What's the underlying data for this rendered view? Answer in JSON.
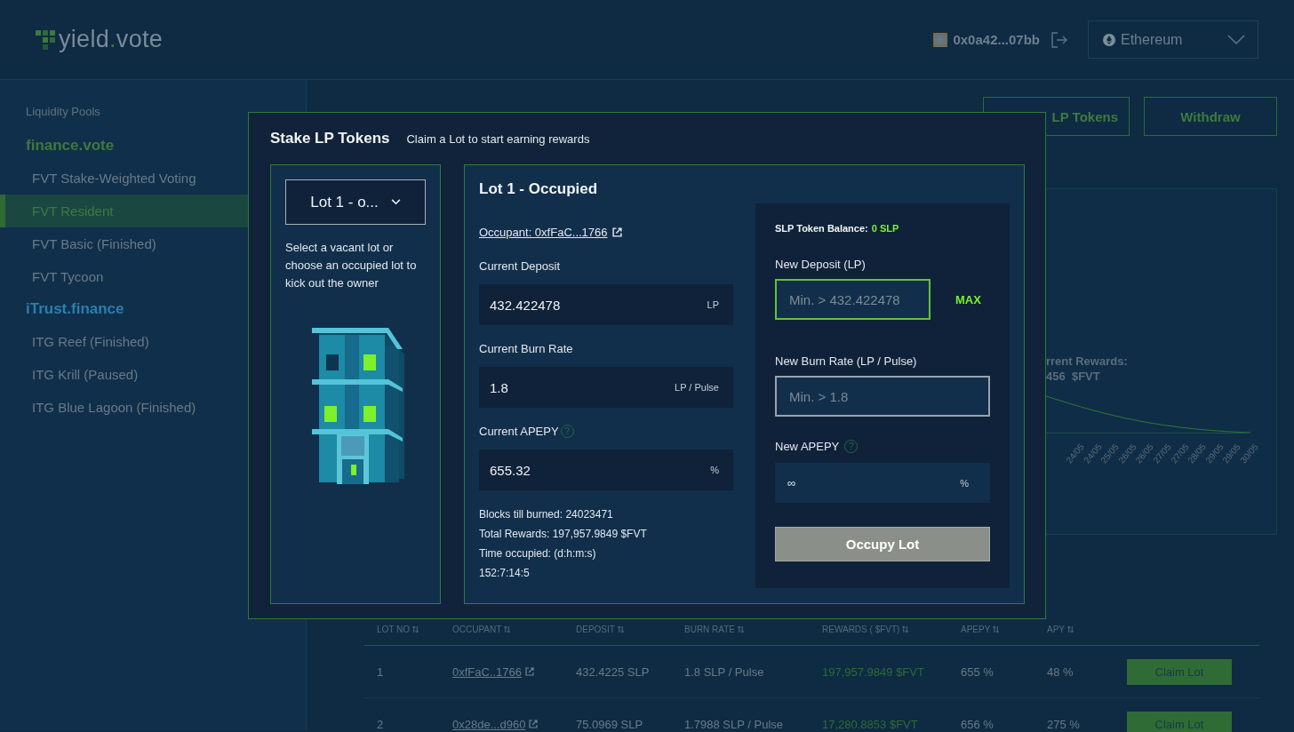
{
  "header": {
    "logo_parts": [
      "yield",
      ".",
      "vote"
    ],
    "wallet": "0x0a42...07bb",
    "network": "Ethereum"
  },
  "sidebar": {
    "heading": "Liquidity Pools",
    "groups": [
      {
        "title": "finance.vote",
        "color": "#3d7a3a",
        "items": [
          {
            "label": "FVT Stake-Weighted Voting",
            "selected": false
          },
          {
            "label": "FVT Resident",
            "selected": true
          },
          {
            "label": "FVT Basic (Finished)",
            "selected": false
          },
          {
            "label": "FVT Tycoon",
            "selected": false
          }
        ]
      },
      {
        "title": "iTrust.finance",
        "color": "#2a7fb0",
        "items": [
          {
            "label": "ITG Reef (Finished)",
            "selected": false
          },
          {
            "label": "ITG Krill (Paused)",
            "selected": false
          },
          {
            "label": "ITG Blue Lagoon (Finished)",
            "selected": false
          }
        ]
      }
    ]
  },
  "actions": [
    "LP Tokens",
    "Withdraw"
  ],
  "chart": {
    "rewards_label": "rrent Rewards:",
    "rewards_value": "456  $FVT",
    "x_labels": [
      "24/05",
      "24/05",
      "25/05",
      "26/05",
      "26/05",
      "27/05",
      "27/05",
      "28/05",
      "29/05",
      "29/05",
      "30/05"
    ]
  },
  "table": {
    "columns": [
      "LOT NO",
      "OCCUPANT",
      "DEPOSIT",
      "BURN RATE",
      "REWARDS ( $FVT)",
      "APEPY",
      "APY"
    ],
    "rows": [
      {
        "lot": "1",
        "occupant": "0xfFaC..1766",
        "deposit": "432.4225 SLP",
        "burn_rate": "1.8 SLP / Pulse",
        "rewards": "197,957.9849 $FVT",
        "apepy": "655 %",
        "apy": "48 %",
        "action": "Claim Lot"
      },
      {
        "lot": "2",
        "occupant": "0x28de...d960",
        "deposit": "75.0969 SLP",
        "burn_rate": "1.7988 SLP / Pulse",
        "rewards": "17,280.8853 $FVT",
        "apepy": "656 %",
        "apy": "275 %",
        "action": "Claim Lot"
      }
    ]
  },
  "modal": {
    "title": "Stake LP Tokens",
    "subtitle": "Claim a Lot to start earning rewards",
    "lot_select": "Lot 1 - o...",
    "hint": "Select a vacant lot or choose an occupied lot to kick out the owner",
    "lot_heading": "Lot 1 - Occupied",
    "occupant": "Occupant: 0xfFaC...1766",
    "current": [
      {
        "label": "Current Deposit",
        "value": "432.422478",
        "unit": "LP"
      },
      {
        "label": "Current Burn Rate",
        "value": "1.8",
        "unit": "LP / Pulse"
      },
      {
        "label": "Current APEPY",
        "help": "?",
        "value": "655.32",
        "unit": "%"
      }
    ],
    "info": [
      "Blocks till burned: 24023471",
      "Total Rewards: 197,957.9849 $FVT",
      "Time occupied: (d:h:m:s)",
      "152:7:14:5"
    ],
    "balance_label": "SLP Token Balance:",
    "balance_value": "0 SLP",
    "new_fields": [
      {
        "kind": "input",
        "label": "New Deposit (LP)",
        "placeholder": "Min. > 432.422478",
        "focused": true,
        "max": "MAX"
      },
      {
        "kind": "input",
        "label": "New Burn Rate (LP / Pulse)",
        "placeholder": "Min. > 1.8",
        "focused": false
      },
      {
        "kind": "readout",
        "label": "New APEPY",
        "help": "?",
        "value": "∞",
        "unit": "%"
      }
    ],
    "submit": "Occupy Lot"
  }
}
